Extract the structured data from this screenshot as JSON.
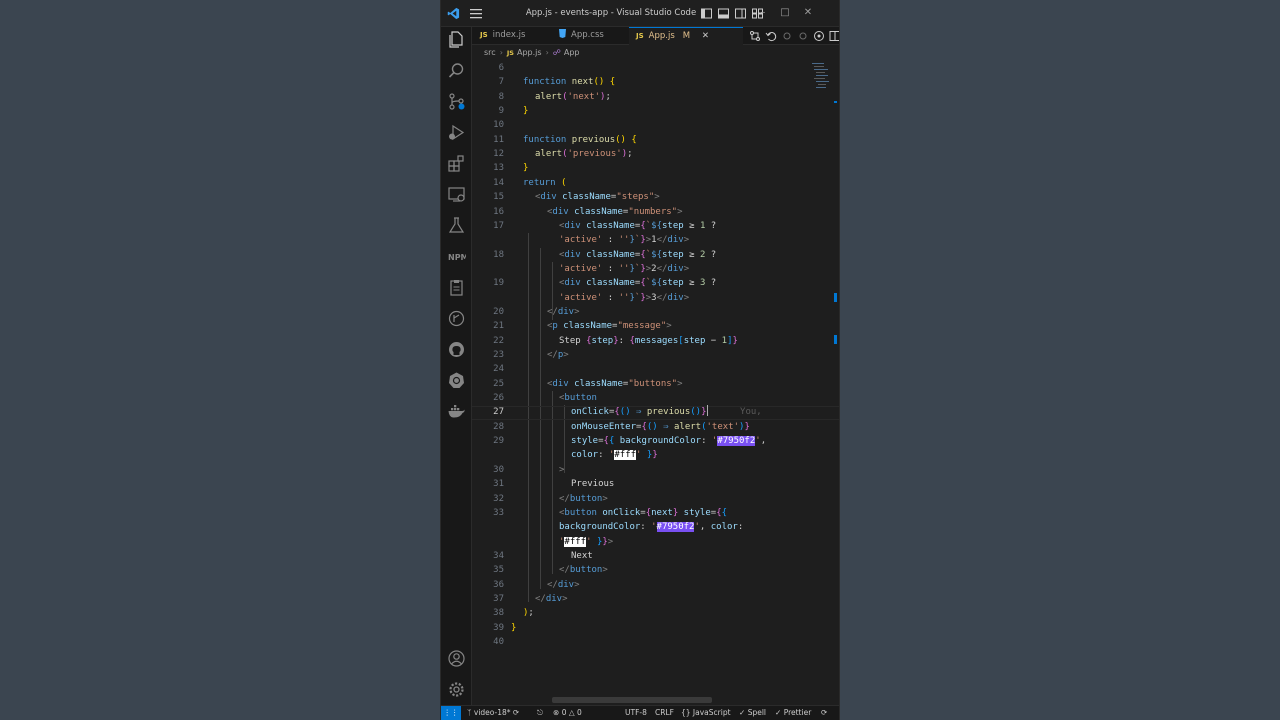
{
  "window": {
    "title": "App.js - events-app - Visual Studio Code",
    "accent": "#0078d4"
  },
  "tabs": [
    {
      "type": "JS",
      "label": "index.js",
      "active": false
    },
    {
      "type": "",
      "label": "App.css",
      "active": false
    },
    {
      "type": "JS",
      "label": "App.js",
      "modified": "M",
      "active": true
    }
  ],
  "breadcrumb": {
    "folder": "src",
    "file_type": "JS",
    "file": "App.js",
    "symbol": "App"
  },
  "editor": {
    "current_line": "27",
    "ghost_text": "You, ",
    "line_numbers": [
      "6",
      "7",
      "8",
      "9",
      "10",
      "11",
      "12",
      "13",
      "14",
      "15",
      "16",
      "17",
      "",
      "18",
      "",
      "19",
      "",
      "20",
      "21",
      "22",
      "23",
      "24",
      "25",
      "26",
      "27",
      "28",
      "29",
      "",
      "30",
      "31",
      "32",
      "33",
      "",
      "",
      "34",
      "35",
      "36",
      "37",
      "38",
      "39",
      "40"
    ],
    "tokens": {
      "function": "function",
      "next_fn": "next",
      "previous_fn": "previous",
      "alert": "alert",
      "str_next": "'next'",
      "str_previous": "'previous'",
      "return": "return",
      "div": "div",
      "p": "p",
      "button": "button",
      "className": "className",
      "onClick": "onClick",
      "onMouseEnter": "onMouseEnter",
      "style": "style",
      "steps": "\"steps\"",
      "numbers": "\"numbers\"",
      "message": "\"message\"",
      "buttons": "\"buttons\"",
      "step": "step",
      "messages": "messages",
      "active": "'active'",
      "empty": "''",
      "str_text": "'text'",
      "backgroundColor": "backgroundColor",
      "color": "color",
      "purple": "#7950f2",
      "white": "#fff",
      "step_label": "Step",
      "previous_label": "Previous",
      "next_label": "Next",
      "one": "1",
      "two": "2",
      "three": "3"
    }
  },
  "statusbar": {
    "branch": "video-18*",
    "errors": "0",
    "warnings": "0",
    "encoding": "UTF-8",
    "eol": "CRLF",
    "language": "{} JavaScript",
    "spell": "Spell",
    "prettier": "Prettier"
  }
}
